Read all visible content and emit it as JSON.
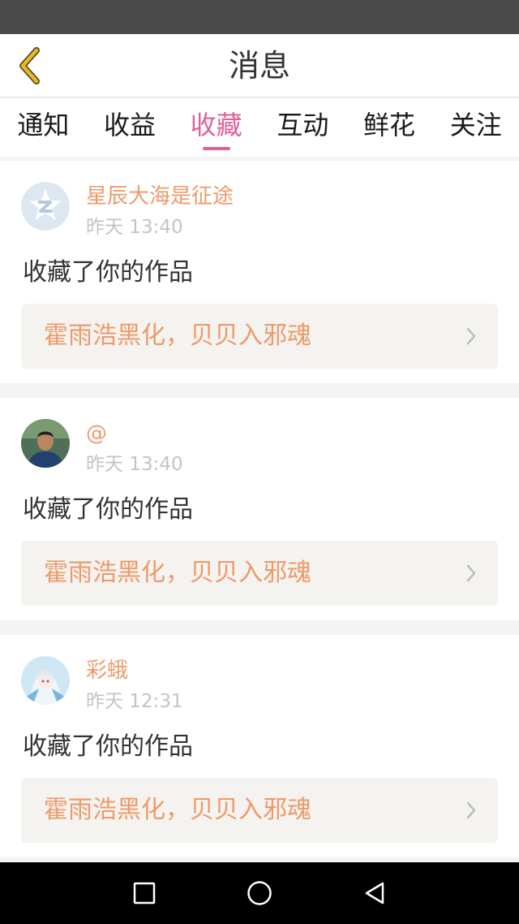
{
  "header": {
    "title": "消息"
  },
  "tabs": [
    {
      "label": "通知",
      "active": false
    },
    {
      "label": "收益",
      "active": false
    },
    {
      "label": "收藏",
      "active": true
    },
    {
      "label": "互动",
      "active": false
    },
    {
      "label": "鲜花",
      "active": false
    },
    {
      "label": "关注",
      "active": false
    }
  ],
  "messages": [
    {
      "username": "星辰大海是征途",
      "time": "昨天 13:40",
      "action": "收藏了你的作品",
      "work_title": "霍雨浩黑化，贝贝入邪魂",
      "avatar_icon": "default-star-avatar-icon"
    },
    {
      "username": "@",
      "time": "昨天 13:40",
      "action": "收藏了你的作品",
      "work_title": "霍雨浩黑化，贝贝入邪魂",
      "avatar_icon": "user-photo-avatar-icon"
    },
    {
      "username": "彩蛾",
      "time": "昨天 12:31",
      "action": "收藏了你的作品",
      "work_title": "霍雨浩黑化，贝贝入邪魂",
      "avatar_icon": "anime-avatar-icon"
    }
  ],
  "colors": {
    "accent": "#e0609a",
    "username": "#ee9a6b",
    "back_arrow": "#e7b82f",
    "status_bar": "#4a4a4a",
    "nav_bar": "#000000"
  }
}
